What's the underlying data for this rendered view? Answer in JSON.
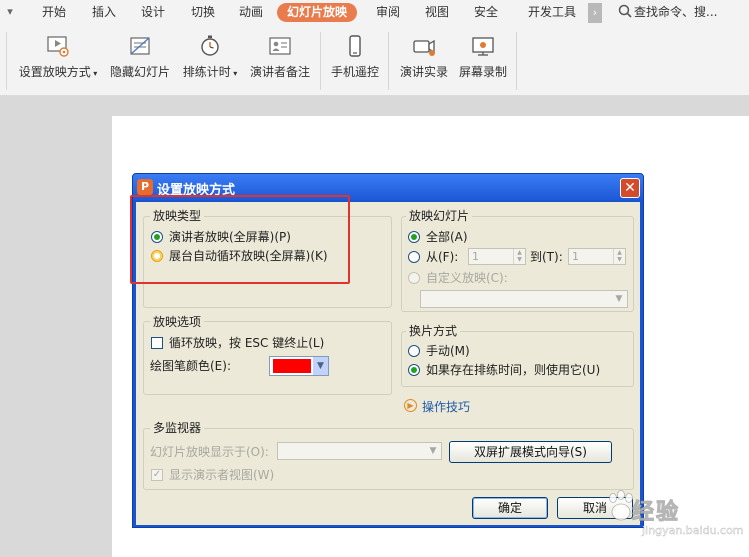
{
  "tabs": [
    "开始",
    "插入",
    "设计",
    "切换",
    "动画",
    "幻灯片放映",
    "审阅",
    "视图",
    "安全",
    "开发工具"
  ],
  "active_tab": "幻灯片放映",
  "search_placeholder": "查找命令、搜...",
  "more_tabs_glyph": "›",
  "ribbon": {
    "setup_show": "设置放映方式",
    "hide_slide": "隐藏幻灯片",
    "rehearse": "排练计时",
    "speaker_notes": "演讲者备注",
    "phone_remote": "手机遥控",
    "record_speech": "演讲实录",
    "screen_record": "屏幕录制"
  },
  "dialog": {
    "title": "设置放映方式",
    "close_glyph": "✕",
    "show_type": {
      "label": "放映类型",
      "speaker": "演讲者放映(全屏幕)(P)",
      "kiosk": "展台自动循环放映(全屏幕)(K)"
    },
    "show_slides": {
      "label": "放映幻灯片",
      "all": "全部(A)",
      "from": "从(F):",
      "from_value": "1",
      "to": "到(T):",
      "to_value": "1",
      "custom": "自定义放映(C):"
    },
    "show_options": {
      "label": "放映选项",
      "loop": "循环放映，按 ESC 键终止(L)",
      "pen_color": "绘图笔颜色(E):",
      "pen_color_value": "#ff0000"
    },
    "advance": {
      "label": "换片方式",
      "manual": "手动(M)",
      "timings": "如果存在排练时间，则使用它(U)"
    },
    "tips_link": "操作技巧",
    "monitors": {
      "label": "多监视器",
      "display_on": "幻灯片放映显示于(O):",
      "presenter_view": "显示演示者视图(W)",
      "dual_screen_button": "双屏扩展模式向导(S)"
    },
    "ok": "确定",
    "cancel": "取消"
  },
  "watermark": {
    "text": "经验",
    "url": "jingyan.baidu.com"
  }
}
